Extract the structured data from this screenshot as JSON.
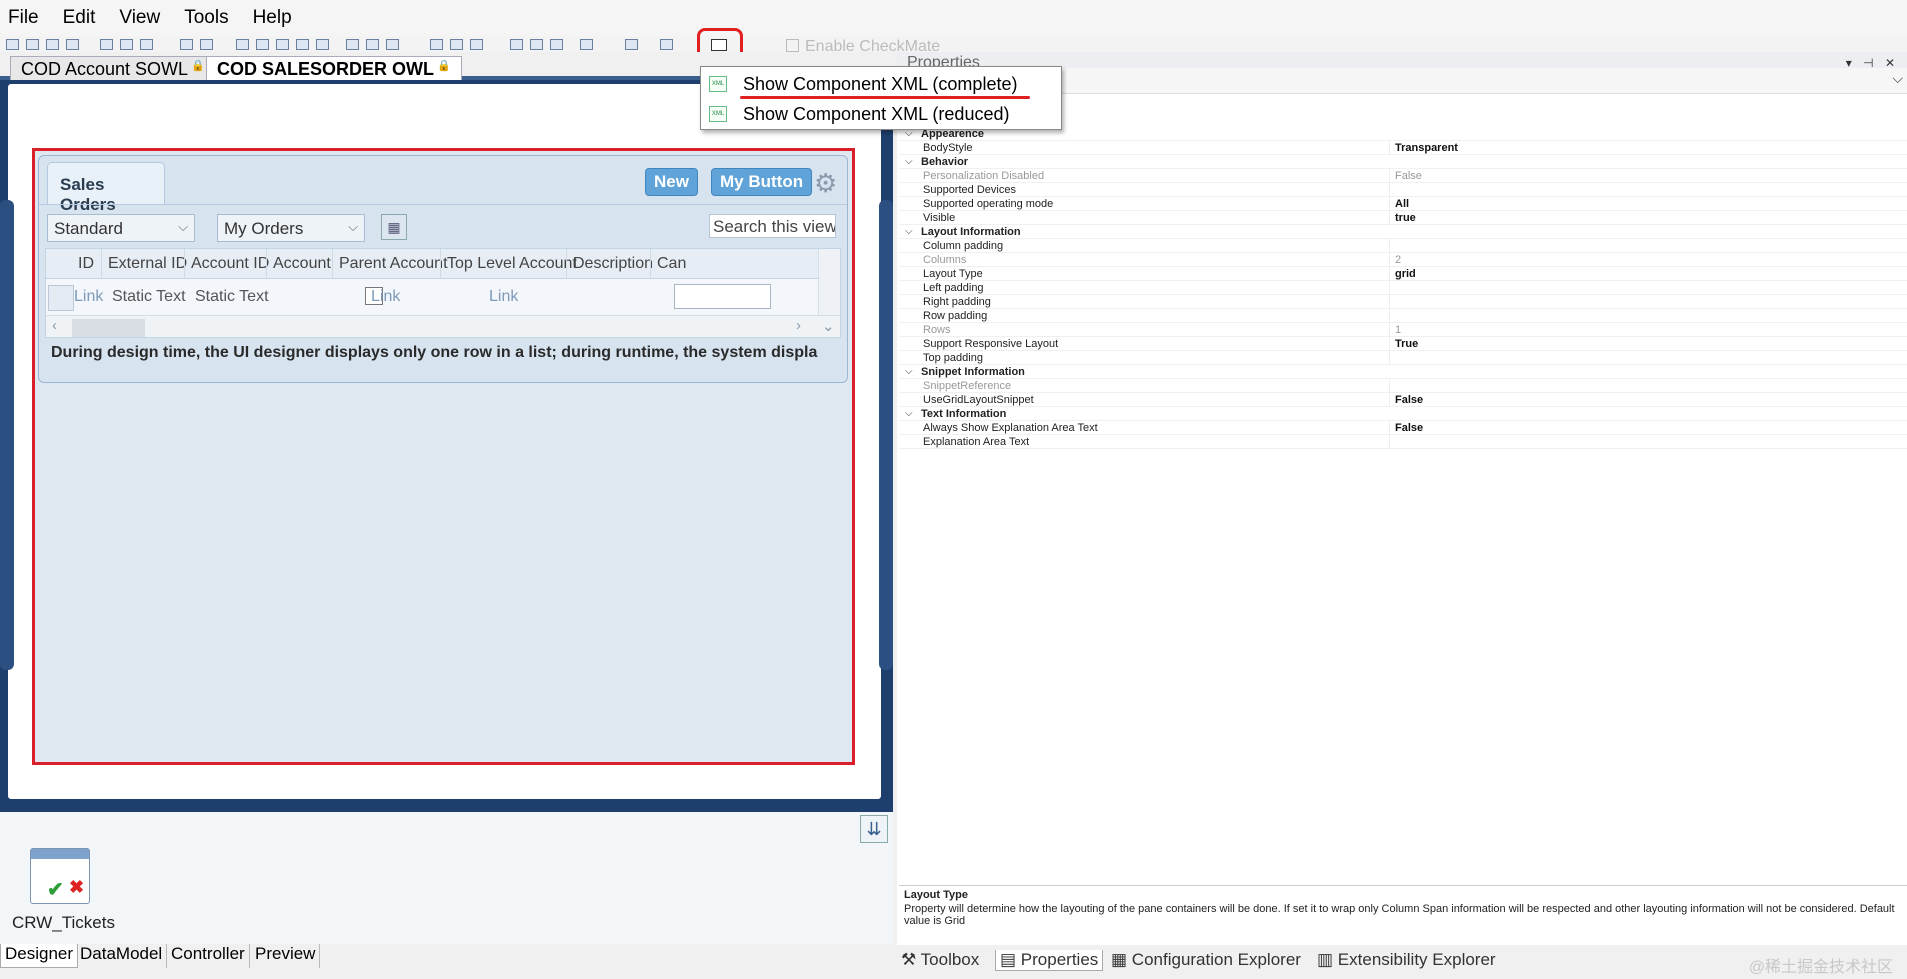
{
  "menu": {
    "items": [
      "File",
      "Edit",
      "View",
      "Tools",
      "Help"
    ]
  },
  "toolbar": {
    "enable_checkmate": "Enable CheckMate"
  },
  "doc_tabs": [
    {
      "label": "COD Account SOWL",
      "active": false
    },
    {
      "label": "COD SALESORDER OWL",
      "active": true
    }
  ],
  "dropdown": {
    "items": [
      "Show Component XML (complete)",
      "Show Component XML (reduced)"
    ],
    "highlighted_index": 0
  },
  "pane": {
    "tab_label": "Sales Orders",
    "new_button": "New",
    "my_button": "My Button",
    "view_select": "Standard",
    "orders_select": "My Orders",
    "search_text": "Search this view",
    "columns": [
      "ID",
      "External ID",
      "Account ID",
      "Account",
      "Parent Account",
      "Top Level Account",
      "Description",
      "Can"
    ],
    "row": {
      "id": "Link",
      "external_id": "Static Text",
      "account_id": "Static Text",
      "parent_account": "Link",
      "top_level_account": "Link"
    },
    "note": "During design time, the UI designer displays only one row in a list; during runtime, the system displa"
  },
  "bottom": {
    "component_label": "CRW_Tickets",
    "tabs": [
      "Designer",
      "DataModel",
      "Controller",
      "Preview"
    ],
    "active_tab": "Designer"
  },
  "properties": {
    "title": "Properties",
    "rows": [
      {
        "type": "cat",
        "name": "Appearence"
      },
      {
        "name": "BodyStyle",
        "value": "Transparent"
      },
      {
        "type": "cat",
        "name": "Behavior"
      },
      {
        "name": "Personalization Disabled",
        "value": "False",
        "dim": true
      },
      {
        "name": "Supported Devices",
        "value": ""
      },
      {
        "name": "Supported operating mode",
        "value": "All"
      },
      {
        "name": "Visible",
        "value": "true"
      },
      {
        "type": "cat",
        "name": "Layout Information"
      },
      {
        "name": "Column padding",
        "value": ""
      },
      {
        "name": "Columns",
        "value": "2",
        "dim": true
      },
      {
        "name": "Layout Type",
        "value": "grid"
      },
      {
        "name": "Left padding",
        "value": ""
      },
      {
        "name": "Right padding",
        "value": ""
      },
      {
        "name": "Row padding",
        "value": ""
      },
      {
        "name": "Rows",
        "value": "1",
        "dim": true
      },
      {
        "name": "Support Responsive Layout",
        "value": "True"
      },
      {
        "name": "Top padding",
        "value": ""
      },
      {
        "type": "cat",
        "name": "Snippet Information"
      },
      {
        "name": "SnippetReference",
        "value": "",
        "dim": true
      },
      {
        "name": "UseGridLayoutSnippet",
        "value": "False"
      },
      {
        "type": "cat",
        "name": "Text Information"
      },
      {
        "name": "Always Show Explanation Area Text",
        "value": "False"
      },
      {
        "name": "Explanation Area Text",
        "value": ""
      }
    ],
    "description_title": "Layout Type",
    "description_text": "Property will determine how the layouting of the pane containers will be done. If set it to wrap only Column Span information will be respected and other layouting information will not be considered. Default value is Grid"
  },
  "right_tabs": [
    "Toolbox",
    "Properties",
    "Configuration Explorer",
    "Extensibility Explorer"
  ],
  "right_active_tab": "Properties",
  "watermark": "@稀土掘金技术社区",
  "colors": {
    "frame_blue": "#1e3e6e",
    "highlight_red": "#e02020",
    "button_blue": "#5fa3d8",
    "link_text": "#7d9ab9"
  }
}
